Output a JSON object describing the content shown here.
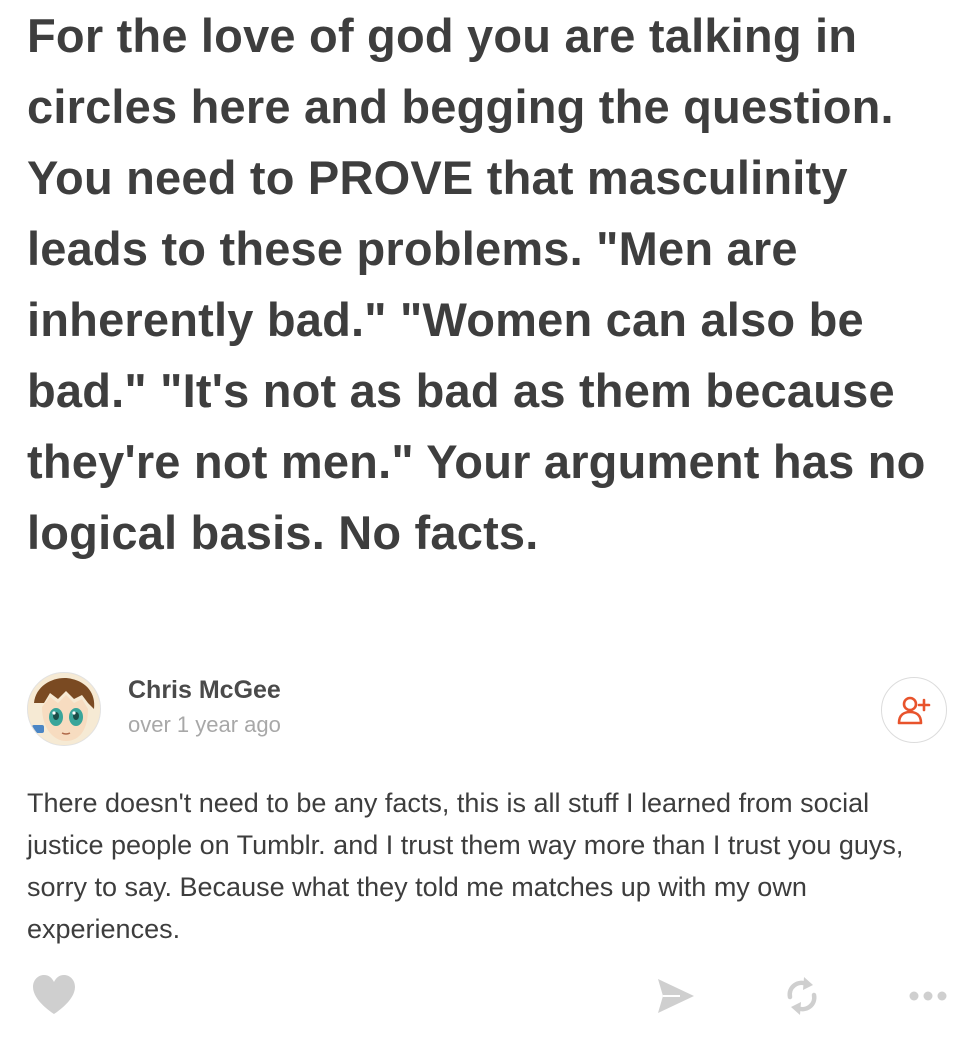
{
  "post": {
    "quote_text": "For the love of god you are talking in circles here and begging the question. You need to PROVE that masculinity leads to these problems. \"Men are inherently bad.\" \"Women can also be bad.\" \"It's not as bad as them because they're not men.\" Your argument has no logical basis. No facts."
  },
  "comment": {
    "author_name": "Chris McGee",
    "timestamp": "over 1 year ago",
    "body": "There doesn't need to be any facts, this is all stuff I learned from social justice people on Tumblr. and I trust them way more than I trust you guys, sorry to say. Because what they told me matches up with my own experiences."
  },
  "icons": {
    "follow": "add-user-icon",
    "like": "heart-icon",
    "share": "send-icon",
    "repost": "repost-icon",
    "more": "more-dots-icon"
  },
  "colors": {
    "accent": "#e8532c",
    "icon_gray": "#cfcfcf",
    "text_dark": "#3e3e3e",
    "text_muted": "#a8a8a8"
  }
}
